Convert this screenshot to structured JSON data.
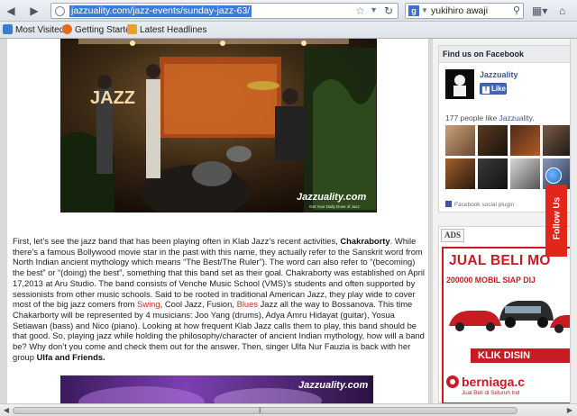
{
  "browser": {
    "url": "jazzuality.com/jazz-events/sunday-jazz-63/",
    "search_engine_icon": "google-icon",
    "search_text": "yukihiro awaji"
  },
  "bookmarks": [
    {
      "label": "Most Visited",
      "icon": "gear-icon",
      "color": "#3b7bd8"
    },
    {
      "label": "Getting Started",
      "icon": "firefox-icon",
      "color": "#e46d1a"
    },
    {
      "label": "Latest Headlines",
      "icon": "rss-feed-icon",
      "color": "#e7a22a"
    }
  ],
  "article": {
    "photo_watermark": "Jazzuality.com",
    "photo_watermark_tagline": "Get Your Daily Dose of Jazz",
    "photo_sign": "JAZZ",
    "p_1a": "First, let’s see the jazz band that has been playing often in Klab Jazz’s recent activities, ",
    "p_bold1": "Chakraborty",
    "p_1b": ". While there’s a famous Bollywood movie star in the past with this name, they actually refer to the Sanskrit word from North Indian ancient mythology which means “The Best/The Ruler”). The word can also refer to “(becoming) the best” or “(doing) the best”, something that this band set as their goal. Chakraborty was established on April 17,2013 at Aru Studio. The band consists of Venche Music School (VMS)’s students and often supported by sessionists from other music schools. Said to be rooted in traditional American Jazz, they play wide to cover most of the big jazz comers from ",
    "link_swing": "Swing",
    "p_1c": ", Cool Jazz, Fusion, ",
    "link_blues": "Blues",
    "p_1d": " Jazz all the way to Bossanova. This time Chakarborty will be represented by 4 musicians: Joo Yang (drums), Adya Amru Hidayat (guitar), Yosua Setiawan (bass) and Nico (piano). Looking at how frequent Klab Jazz calls them to play, this band should be that good. So, playing jazz while holding the philosophy/character of ancient Indian mythology, how will a band be? Why don’t you come and check them out for the answer. Then, singer Ulfa Nur Fauzia is back with her group ",
    "p_bold2": "Ulfa and Friends."
  },
  "sidebar": {
    "fb_title": "Find us on Facebook",
    "fb_page_name": "Jazzuality",
    "fb_like_label": "Like",
    "fb_count_prefix": "177 people like ",
    "fb_count_link": "Jazzuality",
    "fb_count_suffix": ".",
    "fb_plugin_label": "Facebook social plugin",
    "ads_title": "ADS",
    "ad": {
      "line1": "JUAL BELI MO",
      "line2_num": "200000",
      "line2_text": " MOBIL SIAP DIJ",
      "klik": "KLIK DISIN",
      "brand": "berniaga.c",
      "sub": "Jual Beli di Seluruh Ind"
    }
  },
  "follow_tab": "Follow Us",
  "colors": {
    "ad_red": "#c81c24",
    "facebook_blue": "#3b5998",
    "follow_red": "#e1261c",
    "link_red": "#cc2b1f"
  }
}
